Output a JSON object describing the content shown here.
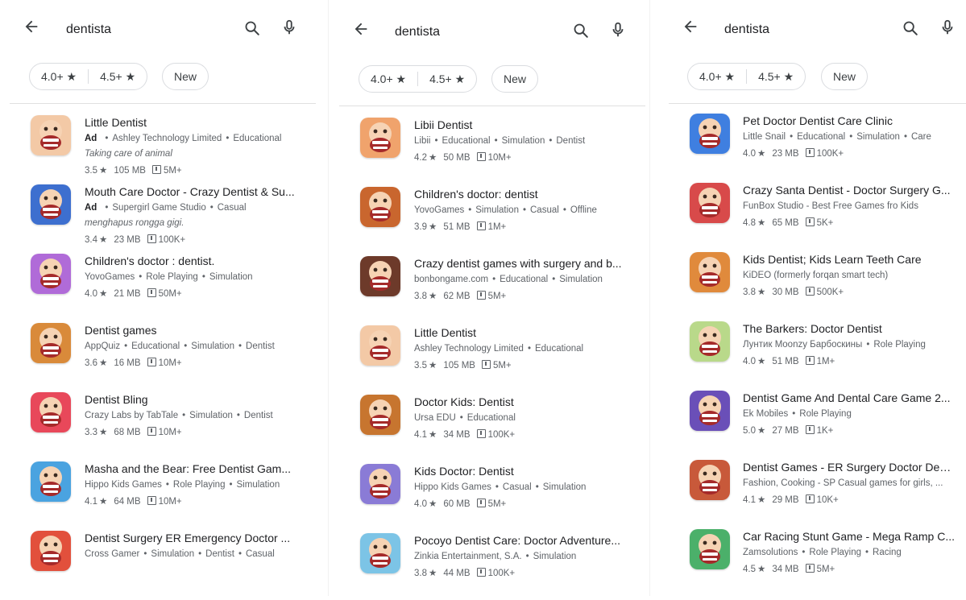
{
  "colors": {
    "chip_border": "#dadce0",
    "text_primary": "#202124",
    "text_secondary": "#5f6368"
  },
  "panels": [
    {
      "search": {
        "query": "dentista"
      },
      "chips": [
        "4.0+ ★",
        "4.5+ ★",
        "New"
      ],
      "apps": [
        {
          "title": "Little Dentist",
          "ad": "Ad",
          "sub": [
            "Ashley Technology Limited",
            "Educational"
          ],
          "tagline": "Taking care of animal",
          "rating": "3.5",
          "size": "105 MB",
          "downloads": "5M+",
          "color": "#f3c9a6"
        },
        {
          "title": "Mouth Care Doctor - Crazy Dentist & Su...",
          "ad": "Ad",
          "sub": [
            "Supergirl Game Studio",
            "Casual"
          ],
          "tagline": "menghapus rongga gigi.",
          "rating": "3.4",
          "size": "23 MB",
          "downloads": "100K+",
          "color": "#3d6fcf"
        },
        {
          "title": "Children's doctor : dentist.",
          "ad": "",
          "sub": [
            "YovoGames",
            "Role Playing",
            "Simulation"
          ],
          "tagline": "",
          "rating": "4.0",
          "size": "21 MB",
          "downloads": "50M+",
          "color": "#b06bd8"
        },
        {
          "title": "Dentist games",
          "ad": "",
          "sub": [
            "AppQuiz",
            "Educational",
            "Simulation",
            "Dentist"
          ],
          "tagline": "",
          "rating": "3.6",
          "size": "16 MB",
          "downloads": "10M+",
          "color": "#d98a3a"
        },
        {
          "title": "Dentist Bling",
          "ad": "",
          "sub": [
            "Crazy Labs by TabTale",
            "Simulation",
            "Dentist"
          ],
          "tagline": "",
          "rating": "3.3",
          "size": "68 MB",
          "downloads": "10M+",
          "color": "#e8485a"
        },
        {
          "title": "Masha and the Bear: Free Dentist Gam...",
          "ad": "",
          "sub": [
            "Hippo Kids Games",
            "Role Playing",
            "Simulation"
          ],
          "tagline": "",
          "rating": "4.1",
          "size": "64 MB",
          "downloads": "10M+",
          "color": "#4aa3e0"
        },
        {
          "title": "Dentist Surgery ER Emergency Doctor ...",
          "ad": "",
          "sub": [
            "Cross Gamer",
            "Simulation",
            "Dentist",
            "Casual"
          ],
          "tagline": "",
          "rating": "",
          "size": "",
          "downloads": "",
          "color": "#e2503c"
        }
      ]
    },
    {
      "search": {
        "query": "dentista"
      },
      "chips": [
        "4.0+ ★",
        "4.5+ ★",
        "New"
      ],
      "apps": [
        {
          "title": "Libii Dentist",
          "ad": "",
          "sub": [
            "Libii",
            "Educational",
            "Simulation",
            "Dentist"
          ],
          "tagline": "",
          "rating": "4.2",
          "size": "50 MB",
          "downloads": "10M+",
          "color": "#f0a36c"
        },
        {
          "title": "Children's doctor: dentist",
          "ad": "",
          "sub": [
            "YovoGames",
            "Simulation",
            "Casual",
            "Offline"
          ],
          "tagline": "",
          "rating": "3.9",
          "size": "51 MB",
          "downloads": "1M+",
          "color": "#c9662e"
        },
        {
          "title": "Crazy dentist games with surgery and b...",
          "ad": "",
          "sub": [
            "bonbongame.com",
            "Educational",
            "Simulation"
          ],
          "tagline": "",
          "rating": "3.8",
          "size": "62 MB",
          "downloads": "5M+",
          "color": "#6d3a2a"
        },
        {
          "title": "Little Dentist",
          "ad": "",
          "sub": [
            "Ashley Technology Limited",
            "Educational"
          ],
          "tagline": "",
          "rating": "3.5",
          "size": "105 MB",
          "downloads": "5M+",
          "color": "#f3c9a6"
        },
        {
          "title": "Doctor Kids: Dentist",
          "ad": "",
          "sub": [
            "Ursa EDU",
            "Educational"
          ],
          "tagline": "",
          "rating": "4.1",
          "size": "34 MB",
          "downloads": "100K+",
          "color": "#c7752f"
        },
        {
          "title": "Kids Doctor: Dentist",
          "ad": "",
          "sub": [
            "Hippo Kids Games",
            "Casual",
            "Simulation"
          ],
          "tagline": "",
          "rating": "4.0",
          "size": "60 MB",
          "downloads": "5M+",
          "color": "#8a7bd6"
        },
        {
          "title": "Pocoyo Dentist Care: Doctor Adventure...",
          "ad": "",
          "sub": [
            "Zinkia Entertainment, S.A.",
            "Simulation"
          ],
          "tagline": "",
          "rating": "3.8",
          "size": "44 MB",
          "downloads": "100K+",
          "color": "#7cc4e6"
        }
      ]
    },
    {
      "search": {
        "query": "dentista"
      },
      "chips": [
        "4.0+ ★",
        "4.5+ ★",
        "New"
      ],
      "apps": [
        {
          "title": "Pet Doctor Dentist Care Clinic",
          "ad": "",
          "sub": [
            "Little Snail",
            "Educational",
            "Simulation",
            "Care"
          ],
          "tagline": "",
          "rating": "4.0",
          "size": "23 MB",
          "downloads": "100K+",
          "color": "#3f7fe0"
        },
        {
          "title": "Crazy Santa Dentist - Doctor Surgery G...",
          "ad": "",
          "sub": [
            "FunBox Studio - Best Free Games fro Kids"
          ],
          "tagline": "",
          "rating": "4.8",
          "size": "65 MB",
          "downloads": "5K+",
          "color": "#d84a4a"
        },
        {
          "title": "Kids Dentist; Kids Learn Teeth Care",
          "ad": "",
          "sub": [
            "KiDEO (formerly forqan smart tech)"
          ],
          "tagline": "",
          "rating": "3.8",
          "size": "30 MB",
          "downloads": "500K+",
          "color": "#e08a3c"
        },
        {
          "title": "The Barkers: Doctor Dentist",
          "ad": "",
          "sub": [
            "Лунтик Moonzy Барбоскины",
            "Role Playing"
          ],
          "tagline": "",
          "rating": "4.0",
          "size": "51 MB",
          "downloads": "1M+",
          "color": "#b9d98a"
        },
        {
          "title": "Dentist Game And Dental Care Game 2...",
          "ad": "",
          "sub": [
            "Ek Mobiles",
            "Role Playing"
          ],
          "tagline": "",
          "rating": "5.0",
          "size": "27 MB",
          "downloads": "1K+",
          "color": "#6a4fb8"
        },
        {
          "title": "Dentist Games - ER Surgery Doctor Den...",
          "ad": "",
          "sub": [
            "Fashion, Cooking - SP Casual games for girls, ..."
          ],
          "tagline": "",
          "rating": "4.1",
          "size": "29 MB",
          "downloads": "10K+",
          "color": "#c8593a"
        },
        {
          "title": "Car Racing Stunt Game - Mega Ramp C...",
          "ad": "",
          "sub": [
            "Zamsolutions",
            "Role Playing",
            "Racing"
          ],
          "tagline": "",
          "rating": "4.5",
          "size": "34 MB",
          "downloads": "5M+",
          "color": "#4bb06a"
        }
      ]
    }
  ]
}
